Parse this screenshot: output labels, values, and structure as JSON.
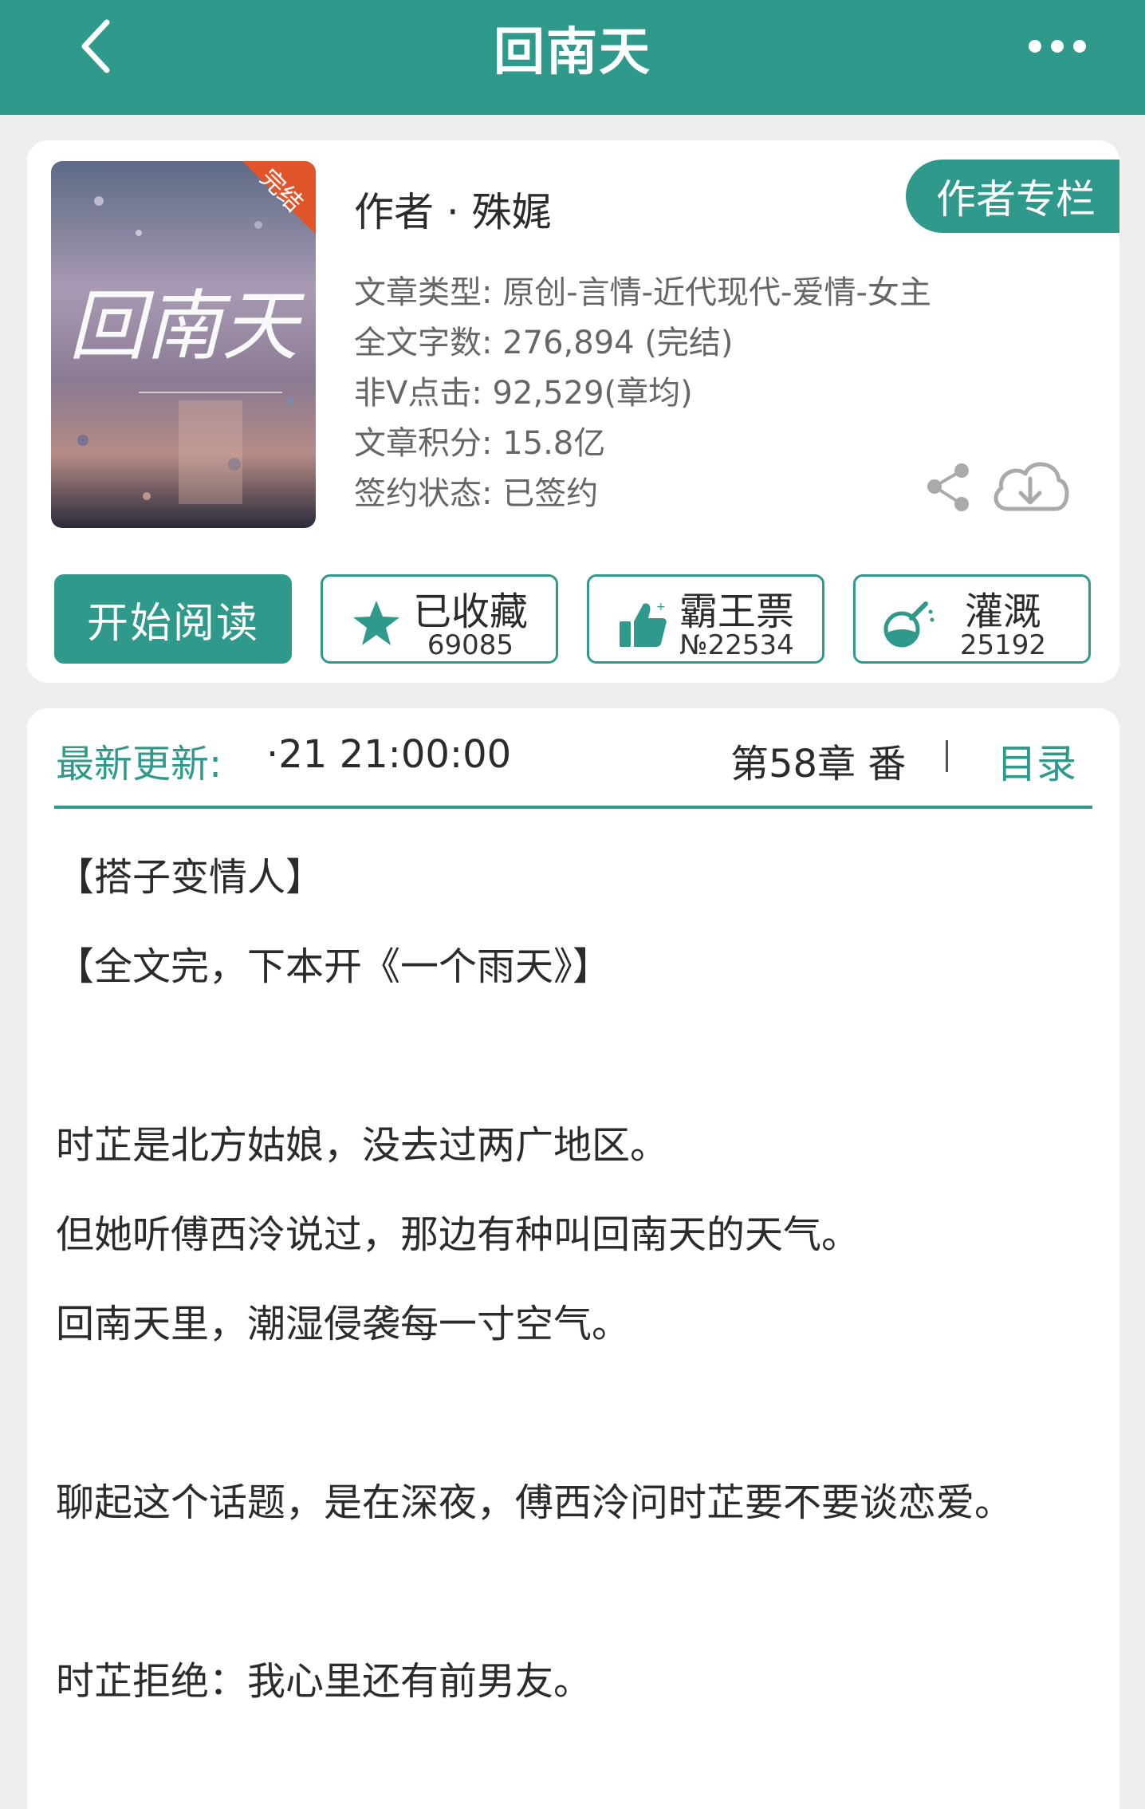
{
  "header": {
    "title": "回南天",
    "back_icon": "back-chevron-icon",
    "more_icon": "more-dots-icon"
  },
  "book": {
    "cover": {
      "title_art": "回南天",
      "badge": "完结"
    },
    "author_line": "作者 · 殊娓",
    "author_column_label": "作者专栏",
    "meta": [
      "文章类型: 原创-言情-近代现代-爱情-女主",
      "全文字数: 276,894 (完结)",
      "非Ⅴ点击: 92,529(章均)",
      "文章积分: 15.8亿",
      "签约状态: 已签约"
    ]
  },
  "actions": {
    "start_read": "开始阅读",
    "collect": {
      "label": "已收藏",
      "count": "69085",
      "icon": "star-icon"
    },
    "vote": {
      "label": "霸王票",
      "count": "№22534",
      "icon": "thumbs-up-icon"
    },
    "water": {
      "label": "灌溉",
      "count": "25192",
      "icon": "nutrient-flask-icon"
    }
  },
  "update": {
    "label": "最新更新:",
    "time": "·21 21:00:00",
    "chapter": "第58章  番",
    "toc": "目录"
  },
  "description": [
    "【搭子变情人】",
    "【全文完，下本开《一个雨天》】",
    "",
    "时芷是北方姑娘，没去过两广地区。",
    "但她听傅西泠说过，那边有种叫回南天的天气。",
    "回南天里，潮湿侵袭每一寸空气。",
    "",
    "聊起这个话题，是在深夜，傅西泠问时芷要不要谈恋爱。",
    "",
    "时芷拒绝：我心里还有前男友。"
  ],
  "colors": {
    "accent": "#2f9a8b",
    "background": "#eeeeee"
  }
}
